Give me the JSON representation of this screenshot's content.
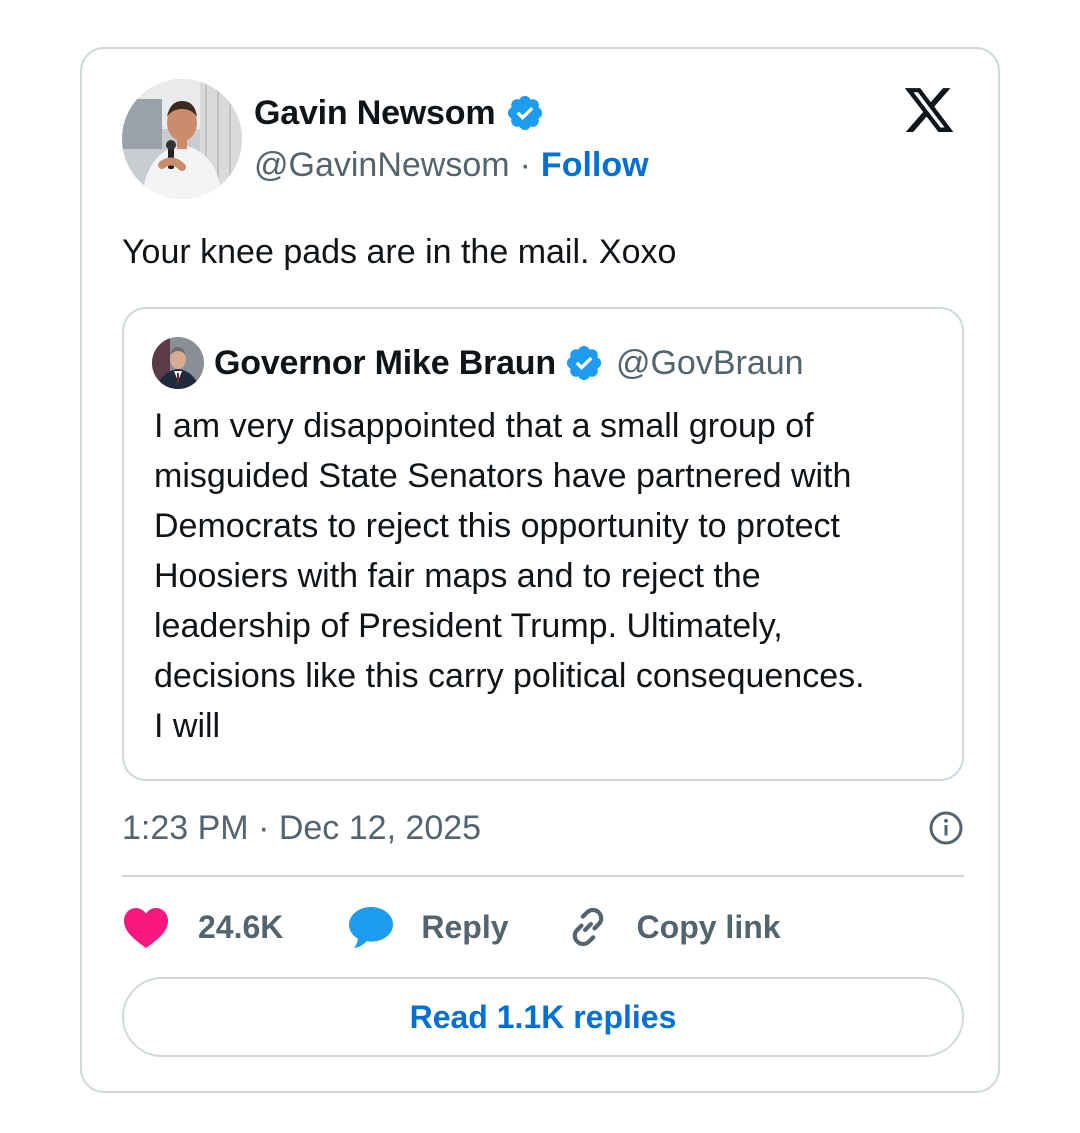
{
  "author": {
    "display_name": "Gavin Newsom",
    "handle": "@GavinNewsom",
    "separator": "·",
    "follow_label": "Follow",
    "verified": true
  },
  "tweet": {
    "text": "Your knee pads are in the mail. Xoxo"
  },
  "quoted_tweet": {
    "display_name": "Governor Mike Braun",
    "handle": "@GovBraun",
    "verified": true,
    "text": "I am very disappointed that a small group of\nmisguided State Senators have partnered with\nDemocrats to reject this opportunity to protect\nHoosiers with fair maps and to reject the\nleadership of President Trump. Ultimately,\ndecisions like this carry political consequences.\nI will"
  },
  "meta": {
    "timestamp": "1:23 PM · Dec 12, 2025"
  },
  "actions": {
    "likes": "24.6K",
    "reply_label": "Reply",
    "copy_link_label": "Copy link"
  },
  "read_replies_label": "Read 1.1K replies",
  "icons": {
    "brand": "x-logo-icon",
    "verified": "verified-badge-icon",
    "info": "info-icon",
    "like": "heart-icon",
    "reply": "speech-bubble-icon",
    "copy": "link-icon"
  },
  "colors": {
    "verified_blue": "#1d9bf0",
    "link_blue": "#006fd6",
    "like_pink": "#f91880",
    "secondary_text": "#536471",
    "border": "#cfd9de"
  }
}
